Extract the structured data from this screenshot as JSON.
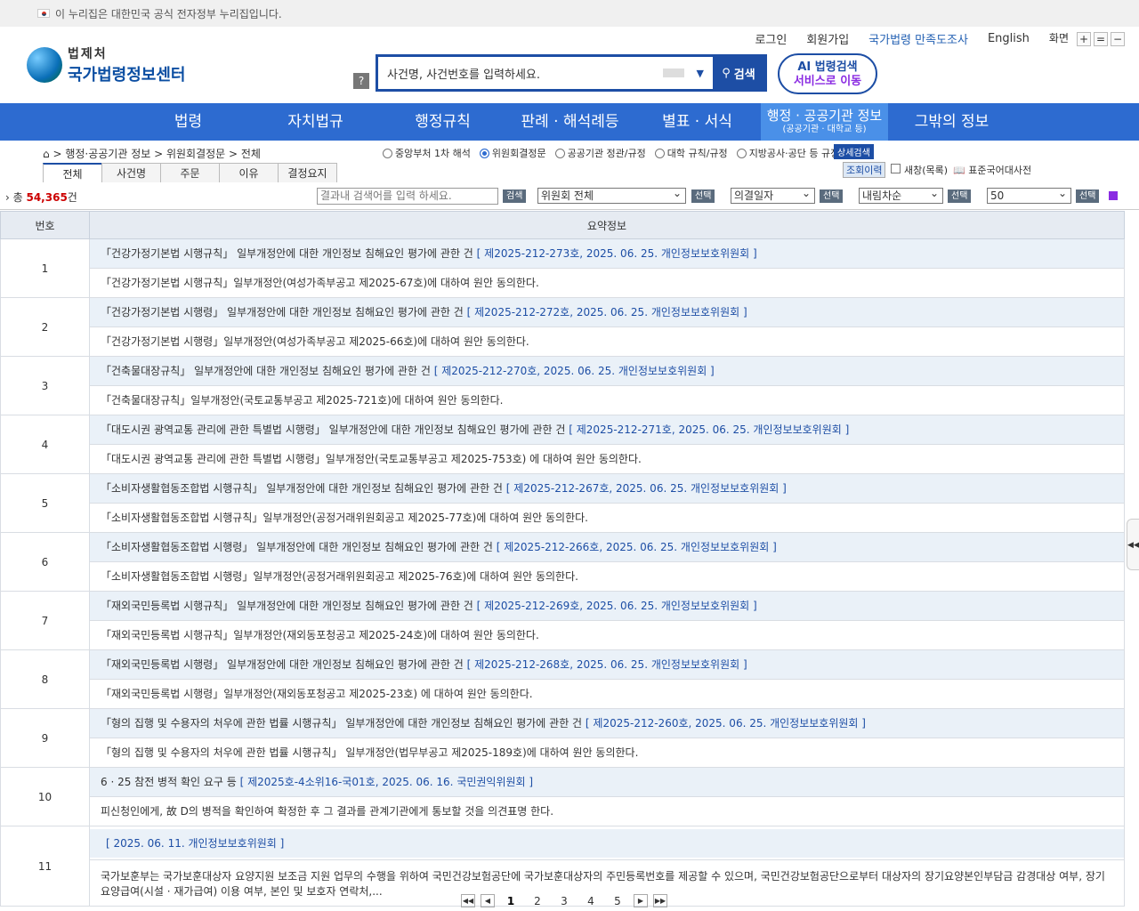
{
  "gov_banner": "이 누리집은 대한민국 공식 전자정부 누리집입니다.",
  "logo": {
    "line1": "법제처",
    "line2": "국가법령정보센터"
  },
  "util": {
    "login": "로그인",
    "join": "회원가입",
    "survey": "국가법령 만족도조사",
    "english": "English",
    "screen": "화면",
    "zoom_in": "+",
    "zoom_reset": "=",
    "zoom_out": "−"
  },
  "search": {
    "help": "?",
    "placeholder": "사건명, 사건번호를 입력하세요.",
    "button": "검색"
  },
  "ai": {
    "line1": "AI 법령검색",
    "line2": "서비스로 이동"
  },
  "nav": [
    "법령",
    "자치법규",
    "행정규칙",
    "판례 · 해석례등",
    "별표 · 서식",
    "행정 · 공공기관 정보",
    "그밖의 정보"
  ],
  "nav_active_sub": "(공공기관 · 대학교 등)",
  "breadcrumb": "> 행정·공공기관 정보 > 위원회결정문 > 전체",
  "radios": [
    "중앙부처 1차 해석",
    "위원회결정문",
    "공공기관 정관/규정",
    "대학 규칙/규정",
    "지방공사·공단 등 규정"
  ],
  "adv_search": "상세검색",
  "history": {
    "view": "조회이력",
    "newwin": "새창(목록)",
    "dict": "표준국어대사전"
  },
  "tabs": [
    "전체",
    "사건명",
    "주문",
    "이유",
    "결정요지"
  ],
  "toolbar": {
    "total_prefix": "총 ",
    "total": "54,365",
    "total_suffix": "건",
    "result_placeholder": "결과내 검색어를 입력 하세요.",
    "search_btn": "검색",
    "committee": "위원회 전체",
    "select": "선택",
    "date": "의결일자",
    "order": "내림차순",
    "count": "50"
  },
  "table": {
    "col_num": "번호",
    "col_summary": "요약정보"
  },
  "rows": [
    {
      "n": "1",
      "title": "「건강가정기본법 시행규칙」 일부개정안에 대한 개인정보 침해요인 평가에 관한 건",
      "link": "[ 제2025-212-273호, 2025. 06. 25. 개인정보보호위원회 ]",
      "summary": "「건강가정기본법 시행규칙」일부개정안(여성가족부공고 제2025-67호)에 대하여 원안 동의한다."
    },
    {
      "n": "2",
      "title": "「건강가정기본법 시행령」 일부개정안에 대한 개인정보 침해요인 평가에 관한 건",
      "link": "[ 제2025-212-272호, 2025. 06. 25. 개인정보보호위원회 ]",
      "summary": "「건강가정기본법 시행령」일부개정안(여성가족부공고 제2025-66호)에 대하여 원안 동의한다."
    },
    {
      "n": "3",
      "title": "「건축물대장규칙」 일부개정안에 대한 개인정보 침해요인 평가에 관한 건",
      "link": "[ 제2025-212-270호, 2025. 06. 25. 개인정보보호위원회 ]",
      "summary": "「건축물대장규칙」일부개정안(국토교통부공고 제2025-721호)에 대하여 원안 동의한다."
    },
    {
      "n": "4",
      "title": "「대도시권 광역교통 관리에 관한 특별법 시행령」 일부개정안에 대한 개인정보 침해요인 평가에 관한 건",
      "link": "[ 제2025-212-271호, 2025. 06. 25. 개인정보보호위원회 ]",
      "summary": "「대도시권 광역교통 관리에 관한 특별법 시행령」일부개정안(국토교통부공고 제2025-753호) 에 대하여 원안 동의한다."
    },
    {
      "n": "5",
      "title": "「소비자생활협동조합법 시행규칙」 일부개정안에 대한 개인정보 침해요인 평가에 관한 건",
      "link": "[ 제2025-212-267호, 2025. 06. 25. 개인정보보호위원회 ]",
      "summary": "「소비자생활협동조합법 시행규칙」일부개정안(공정거래위원회공고 제2025-77호)에 대하여 원안 동의한다."
    },
    {
      "n": "6",
      "title": "「소비자생활협동조합법 시행령」 일부개정안에 대한 개인정보 침해요인 평가에 관한 건",
      "link": "[ 제2025-212-266호, 2025. 06. 25. 개인정보보호위원회 ]",
      "summary": "「소비자생활협동조합법 시행령」일부개정안(공정거래위원회공고 제2025-76호)에 대하여 원안 동의한다."
    },
    {
      "n": "7",
      "title": "「재외국민등록법 시행규칙」 일부개정안에 대한 개인정보 침해요인 평가에 관한 건",
      "link": "[ 제2025-212-269호, 2025. 06. 25. 개인정보보호위원회 ]",
      "summary": "「재외국민등록법 시행규칙」일부개정안(재외동포청공고 제2025-24호)에 대하여 원안 동의한다."
    },
    {
      "n": "8",
      "title": "「재외국민등록법 시행령」 일부개정안에 대한 개인정보 침해요인 평가에 관한 건",
      "link": "[ 제2025-212-268호, 2025. 06. 25. 개인정보보호위원회 ]",
      "summary": "「재외국민등록법 시행령」일부개정안(재외동포청공고 제2025-23호) 에 대하여 원안 동의한다."
    },
    {
      "n": "9",
      "title": "「형의 집행 및 수용자의 처우에 관한 법률 시행규칙」 일부개정안에 대한 개인정보 침해요인 평가에 관한 건",
      "link": "[ 제2025-212-260호, 2025. 06. 25. 개인정보보호위원회 ]",
      "summary": "「형의 집행 및 수용자의 처우에 관한 법률 시행규칙」 일부개정안(법무부공고 제2025-189호)에 대하여 원안 동의한다."
    },
    {
      "n": "10",
      "title": "6 · 25 참전 병적 확인 요구 등",
      "link": "[ 제2025호-4소위16-국01호, 2025. 06. 16. 국민권익위원회 ]",
      "summary": "피신청인에게, 故 D의 병적을 확인하여 확정한 후 그 결과를 관계기관에게 통보할 것을 의견표명 한다."
    }
  ],
  "row11": {
    "n": "11",
    "link": "[ 2025. 06. 11. 개인정보보호위원회 ]",
    "summary": "국가보훈부는 국가보훈대상자 요양지원 보조금 지원 업무의 수행을 위하여 국민건강보험공단에 국가보훈대상자의 주민등록번호를 제공할 수 있으며, 국민건강보험공단으로부터 대상자의 장기요양본인부담금 감경대상 여부, 장기요양급여(시설 · 재가급여) 이용 여부, 본인 및 보호자 연락처,..."
  },
  "pager": {
    "first": "◀◀",
    "prev": "◀",
    "pages": [
      "1",
      "2",
      "3",
      "4",
      "5"
    ],
    "next": "▶",
    "last": "▶▶"
  },
  "side_toggle": "◀◀",
  "colors": {
    "primary": "#1d4ea5",
    "nav": "#2d6bd0",
    "total": "#c00"
  }
}
